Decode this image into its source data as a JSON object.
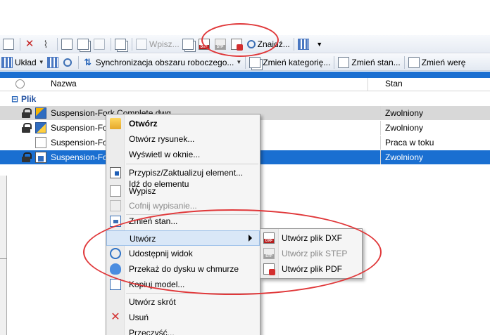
{
  "toolbar1": {
    "wpisz_label": "Wpisz...",
    "znajdz_label": "Znajdź...",
    "icons": [
      "doc-icon",
      "x-icon",
      "paperclip-icon",
      "new-doc-icon",
      "copy-icon",
      "folder-icon",
      "move-icon",
      "wpisz-icon",
      "doc-prop-icon",
      "dxf-icon",
      "step-icon",
      "pdf-icon",
      "find-icon",
      "tools-icon"
    ]
  },
  "toolbar2": {
    "uklad_label": "Układ",
    "sync_label": "Synchronizacja obszaru roboczego...",
    "zmien_kategorie": "Zmień kategorię...",
    "zmien_stan": "Zmień stan...",
    "zmien_wersje": "Zmień werę"
  },
  "columns": {
    "name": "Nazwa",
    "state": "Stan"
  },
  "group": {
    "label": "Plik"
  },
  "rows": [
    {
      "name": "Suspension-Fork Complete.dwg",
      "state": "Zwolniony"
    },
    {
      "name": "Suspension-Fo",
      "state": "Zwolniony"
    },
    {
      "name": "Suspension-Fo",
      "state": "Praca w toku"
    },
    {
      "name": "Suspension-Fo",
      "state": "Zwolniony"
    }
  ],
  "context_menu": {
    "otworz": "Otwórz",
    "otworz_rysunek": "Otwórz rysunek...",
    "wyswietl": "Wyświetl w oknie...",
    "przypisz": "Przypisz/Zaktualizuj element...",
    "idz": "Idź do elementu",
    "wypisz": "Wypisz",
    "cofnij": "Cofnij wypisanie...",
    "zmien_stan": "Zmień stan...",
    "utworz": "Utwórz",
    "udostepnij": "Udostępnij widok",
    "przekaz": "Przekaż do dysku w chmurze",
    "kopiuj": "Kopiuj model...",
    "skrot": "Utwórz skrót",
    "usun": "Usuń",
    "przeczysc": "Przeczyść..."
  },
  "submenu": {
    "dxf": "Utwórz plik DXF",
    "step": "Utwórz plik STEP",
    "pdf": "Utwórz plik PDF"
  },
  "colors": {
    "selection": "#1a6fd1",
    "annotation": "#e0383a"
  }
}
